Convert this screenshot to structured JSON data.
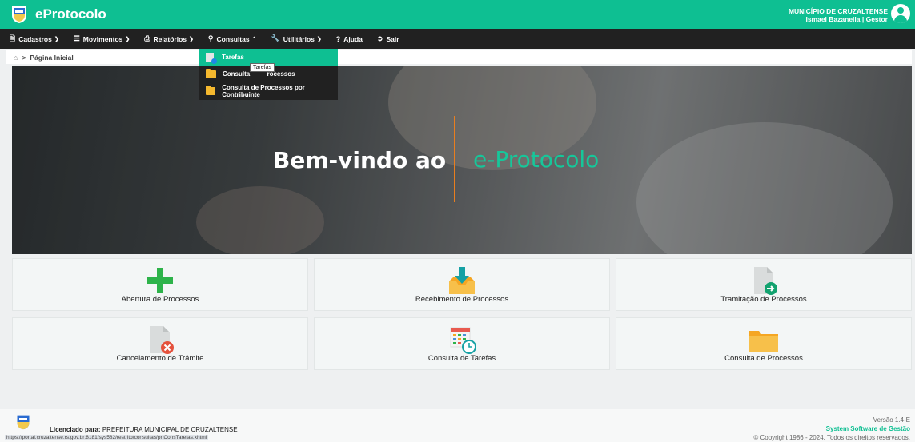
{
  "header": {
    "app_title": "eProtocolo",
    "org_name": "MUNICÍPIO DE CRUZALTENSE",
    "user_line": "Ismael Bazanella | Gestor",
    "brand_color": "#0ebf92"
  },
  "nav": {
    "items": [
      {
        "label": "Cadastros",
        "icon": "document-icon"
      },
      {
        "label": "Movimentos",
        "icon": "list-icon"
      },
      {
        "label": "Relatórios",
        "icon": "printer-icon"
      },
      {
        "label": "Consultas",
        "icon": "search-icon"
      },
      {
        "label": "Utilitários",
        "icon": "wrench-icon"
      },
      {
        "label": "Ajuda",
        "icon": "question-icon"
      },
      {
        "label": "Sair",
        "icon": "sign-out-icon"
      }
    ]
  },
  "breadcrumb": {
    "current": "Página Inicial"
  },
  "consultas_menu": {
    "items": [
      {
        "label": "Tarefas",
        "icon": "tasks-icon"
      },
      {
        "label": "Consulta de Processos",
        "icon": "folder-icon"
      },
      {
        "label": "Consulta de Processos por Contribuinte",
        "icon": "folder-icon"
      }
    ],
    "tooltip": "Tarefas",
    "visible_second_item_prefix": "Consulta ",
    "visible_second_item_suffix": "rocessos"
  },
  "hero": {
    "welcome_prefix": "Bem-vindo ao",
    "welcome_product": "e-Protocolo"
  },
  "shortcuts": [
    {
      "label": "Abertura de Processos",
      "icon": "plus-icon"
    },
    {
      "label": "Recebimento de Processos",
      "icon": "inbox-download-icon"
    },
    {
      "label": "Tramitação de Processos",
      "icon": "document-forward-icon"
    },
    {
      "label": "Cancelamento de Trâmite",
      "icon": "document-cancel-icon"
    },
    {
      "label": "Consulta de Tarefas",
      "icon": "calendar-clock-icon"
    },
    {
      "label": "Consulta de Processos",
      "icon": "folder-icon"
    }
  ],
  "footer": {
    "licensed_label": "Licenciado para:",
    "licensed_to": "PREFEITURA MUNICIPAL DE CRUZALTENSE",
    "status_url": "https://portal.cruzaltense.rs.gov.br:8181/sys582/restrito/consultas/prtConsTarefas.xhtml",
    "version": "Versão 1.4-E",
    "vendor": "System Software de Gestão",
    "copyright": "© Copyright 1986 - 2024. Todos os direitos reservados."
  }
}
